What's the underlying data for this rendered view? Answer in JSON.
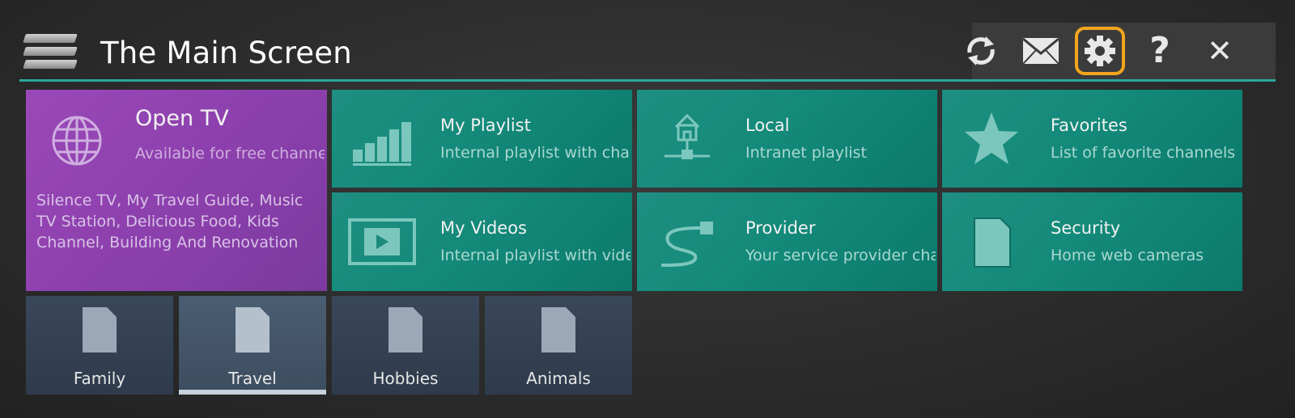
{
  "header": {
    "title": "The Main Screen"
  },
  "toolbar": {
    "buttons": [
      {
        "icon": "refresh-icon"
      },
      {
        "icon": "mail-icon"
      },
      {
        "icon": "gear-icon",
        "highlighted": true
      },
      {
        "icon": "help-icon",
        "glyph": "?"
      },
      {
        "icon": "close-icon",
        "glyph": "✕"
      }
    ]
  },
  "tiles": {
    "open_tv": {
      "title": "Open TV",
      "subtitle": "Available for free channels",
      "description": "Silence TV, My Travel Guide, Music TV Station, Delicious Food, Kids Channel, Building And Renovation"
    },
    "my_playlist": {
      "title": "My Playlist",
      "subtitle": "Internal playlist with channels"
    },
    "local": {
      "title": "Local",
      "subtitle": "Intranet playlist"
    },
    "favorites": {
      "title": "Favorites",
      "subtitle": "List of favorite channels"
    },
    "my_videos": {
      "title": "My Videos",
      "subtitle": "Internal playlist with videos"
    },
    "provider": {
      "title": "Provider",
      "subtitle": "Your service provider channels"
    },
    "security": {
      "title": "Security",
      "subtitle": "Home web cameras"
    }
  },
  "categories": [
    {
      "label": "Family",
      "active": false
    },
    {
      "label": "Travel",
      "active": true
    },
    {
      "label": "Hobbies",
      "active": false
    },
    {
      "label": "Animals",
      "active": false
    }
  ],
  "colors": {
    "accent": "#2aa89c",
    "highlight": "#f2a51c",
    "teal_tile": "#148a7a",
    "purple_tile": "#8a3fab"
  }
}
